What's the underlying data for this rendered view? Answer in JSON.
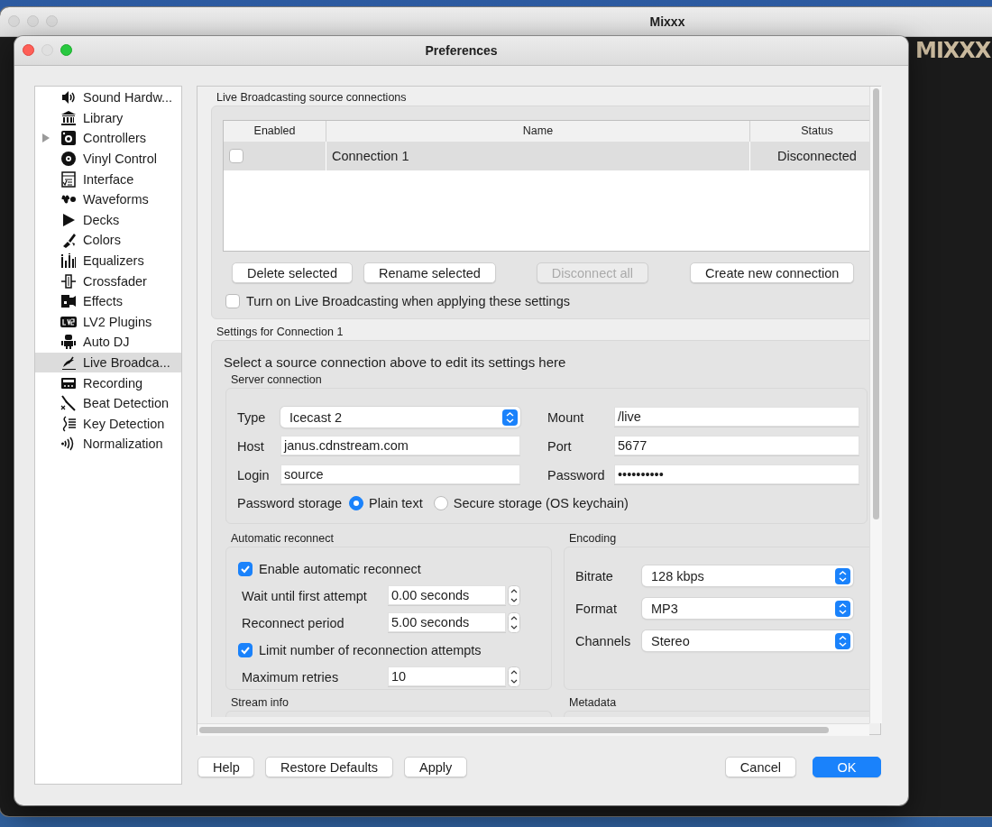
{
  "main_window": {
    "title": "Mixxx",
    "active": false,
    "logo": "MIXXX"
  },
  "dialog": {
    "title": "Preferences",
    "active": true
  },
  "sidebar": {
    "items": [
      {
        "label": "Sound Hardw...",
        "expandable": false,
        "selected": false
      },
      {
        "label": "Library",
        "expandable": false,
        "selected": false
      },
      {
        "label": "Controllers",
        "expandable": true,
        "selected": false
      },
      {
        "label": "Vinyl Control",
        "expandable": false,
        "selected": false
      },
      {
        "label": "Interface",
        "expandable": false,
        "selected": false
      },
      {
        "label": "Waveforms",
        "expandable": false,
        "selected": false
      },
      {
        "label": "Decks",
        "expandable": false,
        "selected": false
      },
      {
        "label": "Colors",
        "expandable": false,
        "selected": false
      },
      {
        "label": "Equalizers",
        "expandable": false,
        "selected": false
      },
      {
        "label": "Crossfader",
        "expandable": false,
        "selected": false
      },
      {
        "label": "Effects",
        "expandable": false,
        "selected": false
      },
      {
        "label": "LV2 Plugins",
        "expandable": false,
        "selected": false
      },
      {
        "label": "Auto DJ",
        "expandable": false,
        "selected": false
      },
      {
        "label": "Live Broadca...",
        "expandable": false,
        "selected": true
      },
      {
        "label": "Recording",
        "expandable": false,
        "selected": false
      },
      {
        "label": "Beat Detection",
        "expandable": false,
        "selected": false
      },
      {
        "label": "Key Detection",
        "expandable": false,
        "selected": false
      },
      {
        "label": "Normalization",
        "expandable": false,
        "selected": false
      }
    ]
  },
  "connections": {
    "title": "Live Broadcasting source connections",
    "table": {
      "columns": [
        "Enabled",
        "Name",
        "Status"
      ],
      "rows": [
        {
          "enabled": false,
          "name": "Connection 1",
          "status": "Disconnected",
          "selected": true
        }
      ]
    },
    "buttons": [
      {
        "label": "Delete selected",
        "disabled": false
      },
      {
        "label": "Rename selected",
        "disabled": false
      },
      {
        "label": "Disconnect all",
        "disabled": true
      },
      {
        "label": "Create new connection",
        "disabled": false
      }
    ],
    "apply_option": {
      "label": "Turn on Live Broadcasting when applying these settings",
      "checked": false
    }
  },
  "settings": {
    "title": "Settings for Connection 1",
    "hint": "Select a source connection above to edit its settings here",
    "server": {
      "title": "Server connection",
      "fields": [
        {
          "kind": "select",
          "label": "Type",
          "value": "Icecast 2"
        },
        {
          "kind": "text",
          "label": "Mount",
          "value": "/live"
        },
        {
          "kind": "text",
          "label": "Host",
          "value": "janus.cdnstream.com"
        },
        {
          "kind": "text",
          "label": "Port",
          "value": "5677"
        },
        {
          "kind": "text",
          "label": "Login",
          "value": "source"
        },
        {
          "kind": "text",
          "label": "Password",
          "value": "••••••••••"
        }
      ],
      "password_storage": {
        "label": "Password storage",
        "options": [
          {
            "label": "Plain text",
            "selected": true
          },
          {
            "label": "Secure storage (OS keychain)",
            "selected": false
          }
        ]
      }
    },
    "reconnect": {
      "title": "Automatic reconnect",
      "items": [
        {
          "kind": "checkbox",
          "label": "Enable automatic reconnect",
          "checked": true
        },
        {
          "kind": "spin",
          "label": "Wait until first attempt",
          "value": "0.00 seconds"
        },
        {
          "kind": "spin",
          "label": "Reconnect period",
          "value": "5.00 seconds"
        },
        {
          "kind": "checkbox",
          "label": "Limit number of reconnection attempts",
          "checked": true
        },
        {
          "kind": "spin",
          "label": "Maximum retries",
          "value": "10"
        }
      ]
    },
    "encoding": {
      "title": "Encoding",
      "fields": [
        {
          "label": "Bitrate",
          "value": "128 kbps"
        },
        {
          "label": "Format",
          "value": "MP3"
        },
        {
          "label": "Channels",
          "value": "Stereo"
        }
      ]
    },
    "more_sections": [
      "Stream info",
      "Metadata"
    ]
  },
  "footer": {
    "buttons": [
      {
        "label": "Help",
        "primary": false
      },
      {
        "label": "Restore Defaults",
        "primary": false
      },
      {
        "label": "Apply",
        "primary": false
      },
      {
        "label": "Cancel",
        "primary": false
      },
      {
        "label": "OK",
        "primary": true
      }
    ]
  }
}
